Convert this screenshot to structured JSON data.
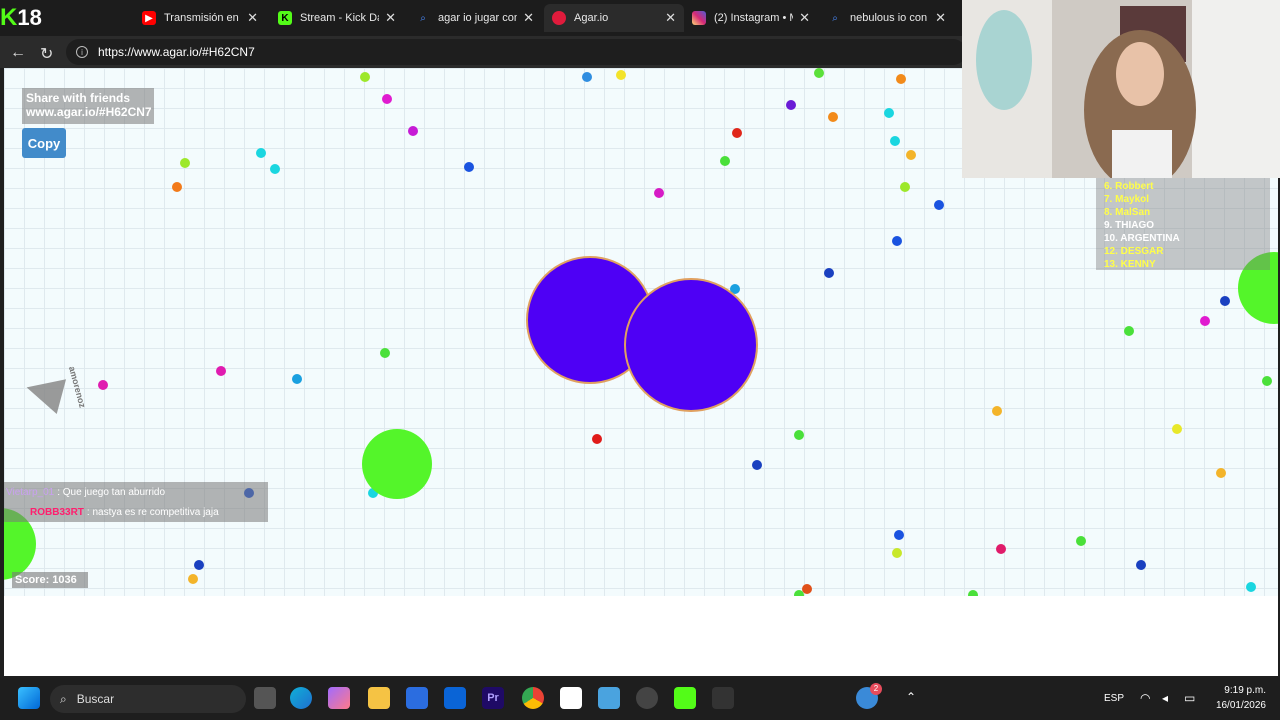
{
  "browser": {
    "kick_badge": "18",
    "tabs": [
      {
        "label": "Transmisión en vivo",
        "fav_color": "#ff0000",
        "fav": "youtube-icon"
      },
      {
        "label": "Stream - Kick Dash",
        "fav_color": "#53fc18",
        "fav": "kick-icon"
      },
      {
        "label": "agar io jugar con a",
        "fav_color": "#4a8cff",
        "fav": "search-icon"
      },
      {
        "label": "Agar.io",
        "fav_color": "#e01b3c",
        "fav": "agar-icon"
      },
      {
        "label": "(2) Instagram • Me",
        "fav_color": "#d62976",
        "fav": "instagram-icon"
      },
      {
        "label": "nebulous io con an",
        "fav_color": "#4a8cff",
        "fav": "search-icon"
      }
    ],
    "url": "https://www.agar.io/#H62CN7"
  },
  "game": {
    "share_title": "Share with friends",
    "share_url": "www.agar.io/#H62CN7",
    "copy_label": "Copy",
    "score_text": "Score: 1036",
    "other_player_name": "amorenoz",
    "leaderboard": [
      {
        "label": "6. Robbert",
        "color": "yellow"
      },
      {
        "label": "7. Maykol",
        "color": "yellow"
      },
      {
        "label": "8. MalSan",
        "color": "yellow"
      },
      {
        "label": "9. THIAGO",
        "color": "white"
      },
      {
        "label": "10. ARGENTINA",
        "color": "white"
      },
      {
        "label": "12. DESGAR",
        "color": "yellow"
      },
      {
        "label": "13. KENNY",
        "color": "yellow"
      }
    ],
    "chat": [
      {
        "name": "Vietarp_01",
        "message": ": Que juego tan aburrido"
      },
      {
        "name": "ROBB33RT",
        "message": ": nastya es re competitiva jaja"
      }
    ],
    "colors": {
      "cell": "#4e00f5",
      "cell_border": "#e0a060",
      "virus": "#54f52a"
    }
  },
  "taskbar": {
    "search_placeholder": "Buscar",
    "language": "ESP",
    "time": "9:19 p.m.",
    "date": "16/01/2026",
    "notification_count": "2"
  }
}
